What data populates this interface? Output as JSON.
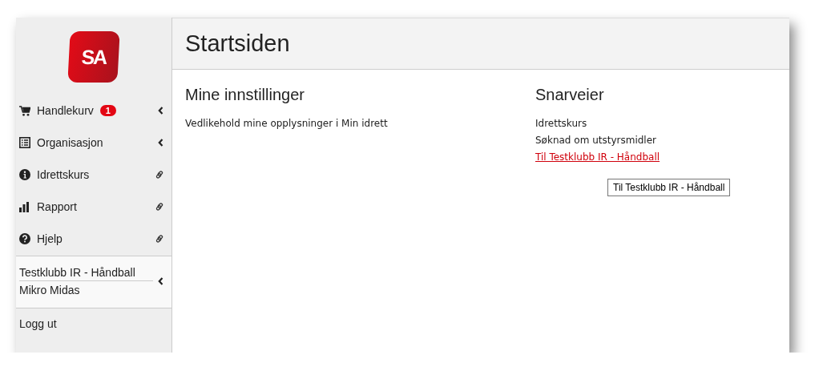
{
  "logo": {
    "text": "SA"
  },
  "menu": [
    {
      "label": "Handlekurv",
      "badge": "1",
      "kind": "submenu"
    },
    {
      "label": "Organisasjon",
      "kind": "submenu"
    },
    {
      "label": "Idrettskurs",
      "kind": "link"
    },
    {
      "label": "Rapport",
      "kind": "link"
    },
    {
      "label": "Hjelp",
      "kind": "link"
    }
  ],
  "account": {
    "club": "Testklubb IR - Håndball",
    "user": "Mikro Midas"
  },
  "logout": "Logg ut",
  "page": {
    "title": "Startsiden"
  },
  "sections": [
    {
      "heading": "Mine innstillinger",
      "items": [
        {
          "text": "Vedlikehold mine opplysninger i Min idrett",
          "kind": "text"
        }
      ]
    },
    {
      "heading": "Snarveier",
      "items": [
        {
          "text": "Idrettskurs",
          "kind": "text"
        },
        {
          "text": "Søknad om utstyrsmidler",
          "kind": "text"
        },
        {
          "text": "Til Testklubb IR - Håndball",
          "kind": "link"
        }
      ]
    }
  ],
  "tooltip": "Til Testklubb IR - Håndball"
}
